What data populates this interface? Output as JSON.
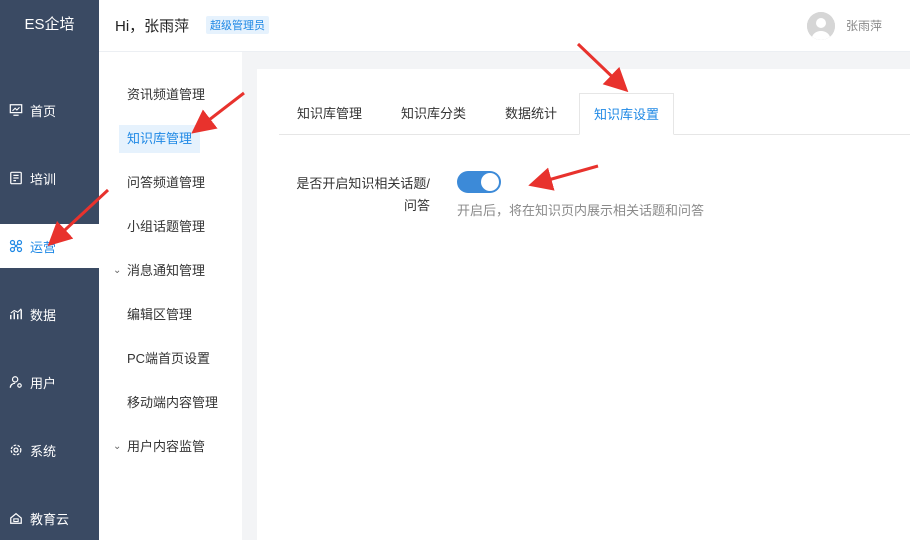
{
  "brand": "ES企培",
  "header": {
    "greeting": "Hi，张雨萍",
    "role_badge": "超级管理员",
    "username": "张雨萍"
  },
  "leftnav": [
    {
      "label": "首页",
      "icon": "monitor-icon"
    },
    {
      "label": "培训",
      "icon": "book-icon"
    },
    {
      "label": "运营",
      "icon": "operations-icon",
      "active": true
    },
    {
      "label": "数据",
      "icon": "chart-icon"
    },
    {
      "label": "用户",
      "icon": "user-icon"
    },
    {
      "label": "系统",
      "icon": "gear-icon"
    },
    {
      "label": "教育云",
      "icon": "cloud-icon"
    }
  ],
  "submenu": [
    {
      "label": "资讯频道管理"
    },
    {
      "label": "知识库管理",
      "active": true
    },
    {
      "label": "问答频道管理"
    },
    {
      "label": "小组话题管理"
    },
    {
      "label": "消息通知管理",
      "expandable": true
    },
    {
      "label": "编辑区管理"
    },
    {
      "label": "PC端首页设置"
    },
    {
      "label": "移动端内容管理"
    },
    {
      "label": "用户内容监管",
      "expandable": true
    }
  ],
  "tabs": [
    {
      "label": "知识库管理"
    },
    {
      "label": "知识库分类"
    },
    {
      "label": "数据统计"
    },
    {
      "label": "知识库设置",
      "active": true
    }
  ],
  "setting": {
    "label_line1": "是否开启知识相关话题/",
    "label_line2": "问答",
    "enabled": true,
    "hint": "开启后，将在知识页内展示相关话题和问答"
  },
  "colors": {
    "nav_bg": "#3a4a63",
    "accent": "#1e88e5",
    "toggle_on": "#3c8ad8",
    "annotation": "#e8322d"
  }
}
